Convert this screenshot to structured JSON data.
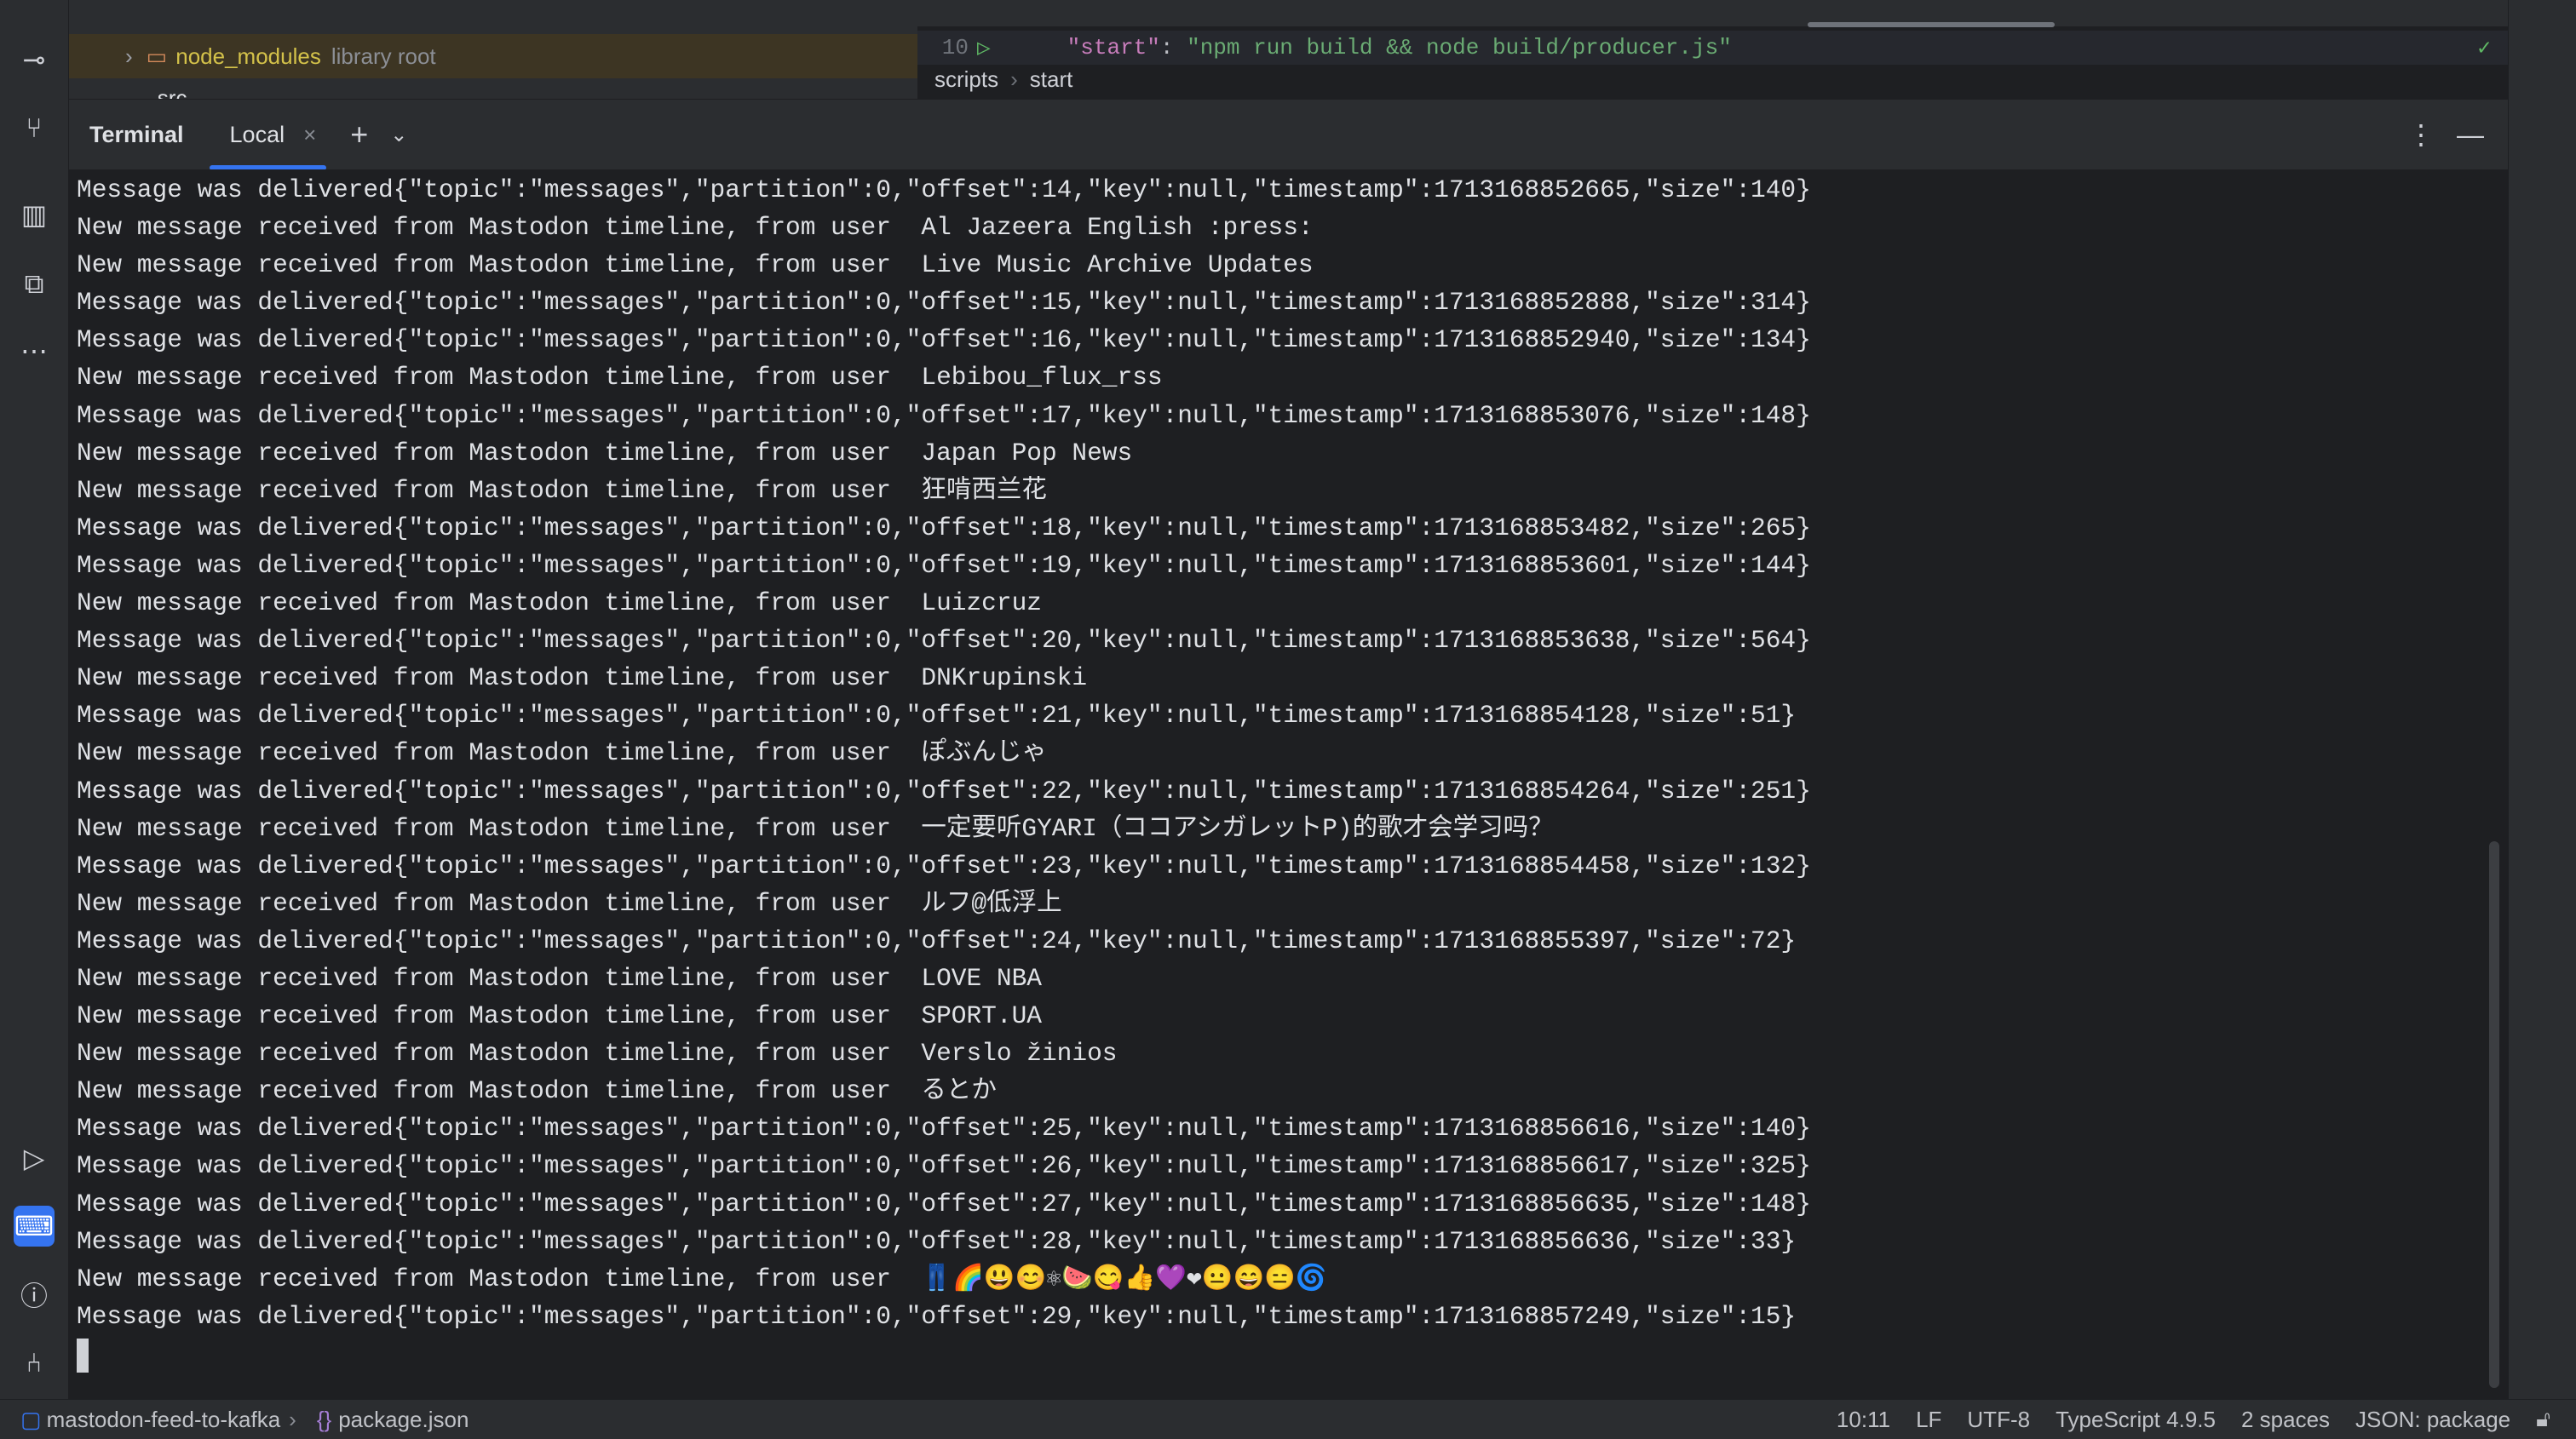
{
  "project": {
    "node_modules": "node_modules",
    "library_root": "library root",
    "src": "src"
  },
  "editor": {
    "line_number": "10",
    "code_key": "\"start\"",
    "code_colon": ": ",
    "code_value": "\"npm run build && node build/producer.js\"",
    "breadcrumbs": [
      "scripts",
      "start"
    ]
  },
  "terminal": {
    "title": "Terminal",
    "tab": "Local",
    "lines": [
      "Message was delivered{\"topic\":\"messages\",\"partition\":0,\"offset\":14,\"key\":null,\"timestamp\":1713168852665,\"size\":140}",
      "New message received from Mastodon timeline, from user  Al Jazeera English :press:",
      "New message received from Mastodon timeline, from user  Live Music Archive Updates",
      "Message was delivered{\"topic\":\"messages\",\"partition\":0,\"offset\":15,\"key\":null,\"timestamp\":1713168852888,\"size\":314}",
      "Message was delivered{\"topic\":\"messages\",\"partition\":0,\"offset\":16,\"key\":null,\"timestamp\":1713168852940,\"size\":134}",
      "New message received from Mastodon timeline, from user  Lebibou_flux_rss",
      "Message was delivered{\"topic\":\"messages\",\"partition\":0,\"offset\":17,\"key\":null,\"timestamp\":1713168853076,\"size\":148}",
      "New message received from Mastodon timeline, from user  Japan Pop News",
      "New message received from Mastodon timeline, from user  狂啃西兰花",
      "Message was delivered{\"topic\":\"messages\",\"partition\":0,\"offset\":18,\"key\":null,\"timestamp\":1713168853482,\"size\":265}",
      "Message was delivered{\"topic\":\"messages\",\"partition\":0,\"offset\":19,\"key\":null,\"timestamp\":1713168853601,\"size\":144}",
      "New message received from Mastodon timeline, from user  Luizcruz",
      "Message was delivered{\"topic\":\"messages\",\"partition\":0,\"offset\":20,\"key\":null,\"timestamp\":1713168853638,\"size\":564}",
      "New message received from Mastodon timeline, from user  DNKrupinski",
      "Message was delivered{\"topic\":\"messages\",\"partition\":0,\"offset\":21,\"key\":null,\"timestamp\":1713168854128,\"size\":51}",
      "New message received from Mastodon timeline, from user  ぽぶんじゃ",
      "Message was delivered{\"topic\":\"messages\",\"partition\":0,\"offset\":22,\"key\":null,\"timestamp\":1713168854264,\"size\":251}",
      "New message received from Mastodon timeline, from user  一定要听GYARI（ココアシガレットP)的歌才会学习吗？",
      "Message was delivered{\"topic\":\"messages\",\"partition\":0,\"offset\":23,\"key\":null,\"timestamp\":1713168854458,\"size\":132}",
      "New message received from Mastodon timeline, from user  ルフ@低浮上",
      "Message was delivered{\"topic\":\"messages\",\"partition\":0,\"offset\":24,\"key\":null,\"timestamp\":1713168855397,\"size\":72}",
      "New message received from Mastodon timeline, from user  LOVE NBA",
      "New message received from Mastodon timeline, from user  SPORT.UA",
      "New message received from Mastodon timeline, from user  Verslo žinios",
      "New message received from Mastodon timeline, from user  るとか",
      "Message was delivered{\"topic\":\"messages\",\"partition\":0,\"offset\":25,\"key\":null,\"timestamp\":1713168856616,\"size\":140}",
      "Message was delivered{\"topic\":\"messages\",\"partition\":0,\"offset\":26,\"key\":null,\"timestamp\":1713168856617,\"size\":325}",
      "Message was delivered{\"topic\":\"messages\",\"partition\":0,\"offset\":27,\"key\":null,\"timestamp\":1713168856635,\"size\":148}",
      "Message was delivered{\"topic\":\"messages\",\"partition\":0,\"offset\":28,\"key\":null,\"timestamp\":1713168856636,\"size\":33}",
      "New message received from Mastodon timeline, from user  👖🌈😃😊⚛🍉😋👍💜❤😐😄😑🌀",
      "Message was delivered{\"topic\":\"messages\",\"partition\":0,\"offset\":29,\"key\":null,\"timestamp\":1713168857249,\"size\":15}"
    ]
  },
  "status": {
    "project": "mastodon-feed-to-kafka",
    "file": "package.json",
    "position": "10:11",
    "line_ending": "LF",
    "encoding": "UTF-8",
    "language": "TypeScript 4.9.5",
    "indent": "2 spaces",
    "schema": "JSON: package"
  }
}
